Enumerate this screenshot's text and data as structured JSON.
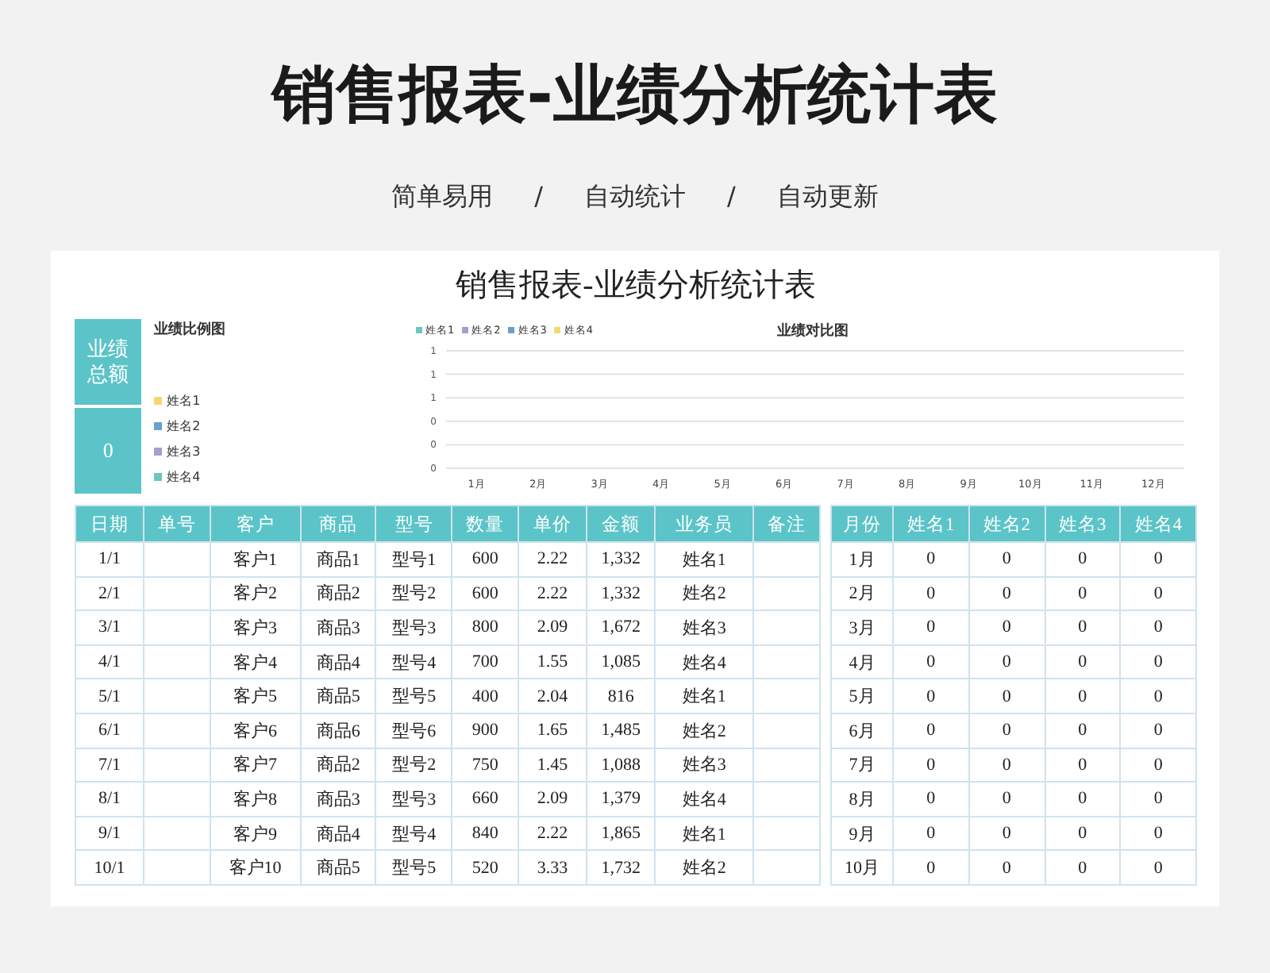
{
  "header": {
    "title": "销售报表-业绩分析统计表",
    "subtitle": [
      "简单易用",
      "/",
      "自动统计",
      "/",
      "自动更新"
    ]
  },
  "sheet": {
    "title": "销售报表-业绩分析统计表",
    "total": {
      "label": "业绩总额",
      "value": "0"
    },
    "pie": {
      "title": "业绩比例图",
      "legend": [
        {
          "label": "姓名1",
          "color": "#f5d76e"
        },
        {
          "label": "姓名2",
          "color": "#6a9fcf"
        },
        {
          "label": "姓名3",
          "color": "#a99ccf"
        },
        {
          "label": "姓名4",
          "color": "#6cc7c0"
        }
      ]
    },
    "bar": {
      "title": "业绩对比图",
      "chart_data": {
        "type": "bar",
        "categories": [
          "1月",
          "2月",
          "3月",
          "4月",
          "5月",
          "6月",
          "7月",
          "8月",
          "9月",
          "10月",
          "11月",
          "12月"
        ],
        "series": [
          {
            "name": "姓名1",
            "color": "#6cc7c0",
            "values": [
              0,
              0,
              0,
              0,
              0,
              0,
              0,
              0,
              0,
              0,
              0,
              0
            ]
          },
          {
            "name": "姓名2",
            "color": "#a99ccf",
            "values": [
              0,
              0,
              0,
              0,
              0,
              0,
              0,
              0,
              0,
              0,
              0,
              0
            ]
          },
          {
            "name": "姓名3",
            "color": "#6a9fcf",
            "values": [
              0,
              0,
              0,
              0,
              0,
              0,
              0,
              0,
              0,
              0,
              0,
              0
            ]
          },
          {
            "name": "姓名4",
            "color": "#f5d76e",
            "values": [
              0,
              0,
              0,
              0,
              0,
              0,
              0,
              0,
              0,
              0,
              0,
              0
            ]
          }
        ],
        "grid": true,
        "ylim": [
          0,
          1
        ],
        "yticks": [
          {
            "value": 0,
            "label": "0"
          },
          {
            "value": 0.2,
            "label": "0"
          },
          {
            "value": 0.4,
            "label": "0"
          },
          {
            "value": 0.6,
            "label": "1"
          },
          {
            "value": 0.8,
            "label": "1"
          },
          {
            "value": 1,
            "label": "1"
          }
        ]
      }
    },
    "sales_table": {
      "columns": [
        "日期",
        "单号",
        "客户",
        "商品",
        "型号",
        "数量",
        "单价",
        "金额",
        "业务员",
        "备注"
      ],
      "rows": [
        {
          "date": "1/1",
          "customer": "客户1",
          "product": "商品1",
          "model": "型号1",
          "qty": "600",
          "price": "2.22",
          "amount": "1,332",
          "salesperson": "姓名1"
        },
        {
          "date": "2/1",
          "customer": "客户2",
          "product": "商品2",
          "model": "型号2",
          "qty": "600",
          "price": "2.22",
          "amount": "1,332",
          "salesperson": "姓名2"
        },
        {
          "date": "3/1",
          "customer": "客户3",
          "product": "商品3",
          "model": "型号3",
          "qty": "800",
          "price": "2.09",
          "amount": "1,672",
          "salesperson": "姓名3"
        },
        {
          "date": "4/1",
          "customer": "客户4",
          "product": "商品4",
          "model": "型号4",
          "qty": "700",
          "price": "1.55",
          "amount": "1,085",
          "salesperson": "姓名4"
        },
        {
          "date": "5/1",
          "customer": "客户5",
          "product": "商品5",
          "model": "型号5",
          "qty": "400",
          "price": "2.04",
          "amount": "816",
          "salesperson": "姓名1"
        },
        {
          "date": "6/1",
          "customer": "客户6",
          "product": "商品6",
          "model": "型号6",
          "qty": "900",
          "price": "1.65",
          "amount": "1,485",
          "salesperson": "姓名2"
        },
        {
          "date": "7/1",
          "customer": "客户7",
          "product": "商品2",
          "model": "型号2",
          "qty": "750",
          "price": "1.45",
          "amount": "1,088",
          "salesperson": "姓名3"
        },
        {
          "date": "8/1",
          "customer": "客户8",
          "product": "商品3",
          "model": "型号3",
          "qty": "660",
          "price": "2.09",
          "amount": "1,379",
          "salesperson": "姓名4"
        },
        {
          "date": "9/1",
          "customer": "客户9",
          "product": "商品4",
          "model": "型号4",
          "qty": "840",
          "price": "2.22",
          "amount": "1,865",
          "salesperson": "姓名1"
        },
        {
          "date": "10/1",
          "customer": "客户10",
          "product": "商品5",
          "model": "型号5",
          "qty": "520",
          "price": "3.33",
          "amount": "1,732",
          "salesperson": "姓名2"
        }
      ]
    },
    "monthly_table": {
      "columns": [
        "月份",
        "姓名1",
        "姓名2",
        "姓名3",
        "姓名4"
      ],
      "rows": [
        [
          "1月",
          "0",
          "0",
          "0",
          "0"
        ],
        [
          "2月",
          "0",
          "0",
          "0",
          "0"
        ],
        [
          "3月",
          "0",
          "0",
          "0",
          "0"
        ],
        [
          "4月",
          "0",
          "0",
          "0",
          "0"
        ],
        [
          "5月",
          "0",
          "0",
          "0",
          "0"
        ],
        [
          "6月",
          "0",
          "0",
          "0",
          "0"
        ],
        [
          "7月",
          "0",
          "0",
          "0",
          "0"
        ],
        [
          "8月",
          "0",
          "0",
          "0",
          "0"
        ],
        [
          "9月",
          "0",
          "0",
          "0",
          "0"
        ],
        [
          "10月",
          "0",
          "0",
          "0",
          "0"
        ]
      ]
    }
  }
}
